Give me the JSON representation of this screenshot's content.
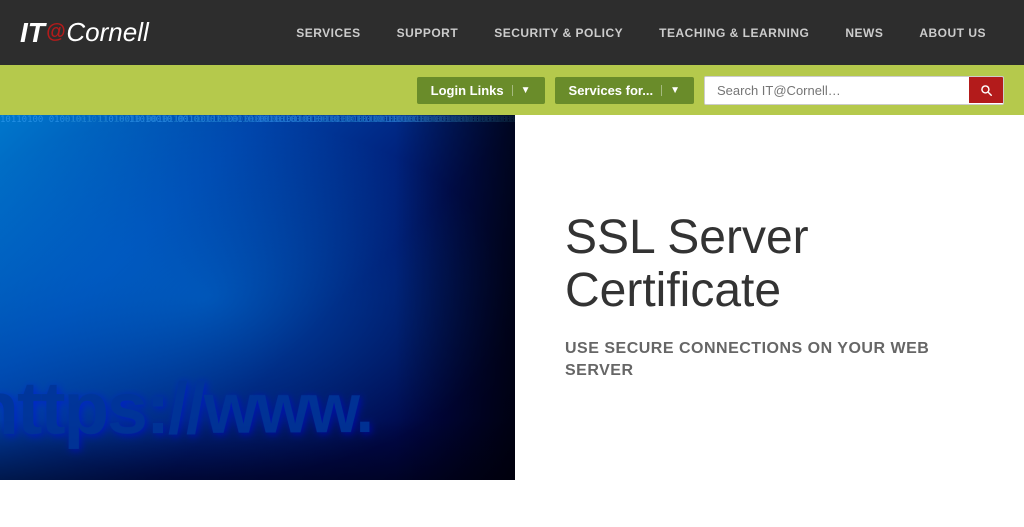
{
  "header": {
    "logo": {
      "it": "IT",
      "at": "@",
      "cornell": "Cornell"
    },
    "nav": [
      {
        "label": "SERVICES",
        "active": false
      },
      {
        "label": "SUPPORT",
        "active": false
      },
      {
        "label": "SECURITY & POLICY",
        "active": false
      },
      {
        "label": "TEACHING & LEARNING",
        "active": false
      },
      {
        "label": "NEWS",
        "active": false
      },
      {
        "label": "ABOUT US",
        "active": false
      }
    ]
  },
  "toolbar": {
    "login_links_label": "Login Links",
    "services_for_label": "Services for...",
    "search_placeholder": "Search IT@Cornell…"
  },
  "hero": {
    "title": "SSL Server Certificate",
    "subtitle": "USE SECURE CONNECTIONS ON YOUR WEB SERVER",
    "https_text": "https://www."
  },
  "binary": {
    "columns": [
      "10110100\n01001011\n11010010\n00101101\n10110100\n01001011\n11010010\n00101101\n10110100\n01001011\n11010010\n00101101\n10110100\n01001011\n11010010\n00101101\n10110100\n01001011",
      "01001011\n10110100\n00101101\n11010010\n01001011\n10110100\n00101101\n11010010\n01001011\n10110100\n00101101\n11010010\n01001011\n10110100\n00101101\n11010010\n01001011\n10110100",
      "11010010\n00101101\n10110100\n01001011\n11010010\n00101101\n10110100\n01001011\n11010010\n00101101\n10110100\n01001011\n11010010\n00101101\n10110100\n01001011\n11010010\n00101101",
      "00101101\n11010010\n01001011\n10110100\n00101101\n11010010\n01001011\n10110100\n00101101\n11010010\n01001011\n10110100\n00101101\n11010010\n01001011\n10110100\n00101101\n11010010",
      "10110100\n01001011\n11010010\n00101101\n10110100\n01001011\n11010010\n00101101\n10110100\n01001011\n11010010\n00101101\n10110100\n01001011\n11010010\n00101101\n10110100\n01001011",
      "01001011\n10110100\n00101101\n11010010\n01001011\n10110100\n00101101\n11010010\n01001011\n10110100\n00101101\n11010010\n01001011\n10110100\n00101101\n11010010\n01001011\n10110100",
      "11010010\n00101101\n10110100\n01001011\n11010010\n00101101\n10110100\n01001011\n11010010\n00101101\n10110100\n01001011\n11010010\n00101101\n10110100\n01001011\n11010010\n00101101",
      "00101101\n11010010\n01001011\n10110100\n00101101\n11010010\n01001011\n10110100\n00101101\n11010010\n01001011\n10110100\n00101101\n11010010\n01001011\n10110100\n00101101\n11010010"
    ]
  }
}
